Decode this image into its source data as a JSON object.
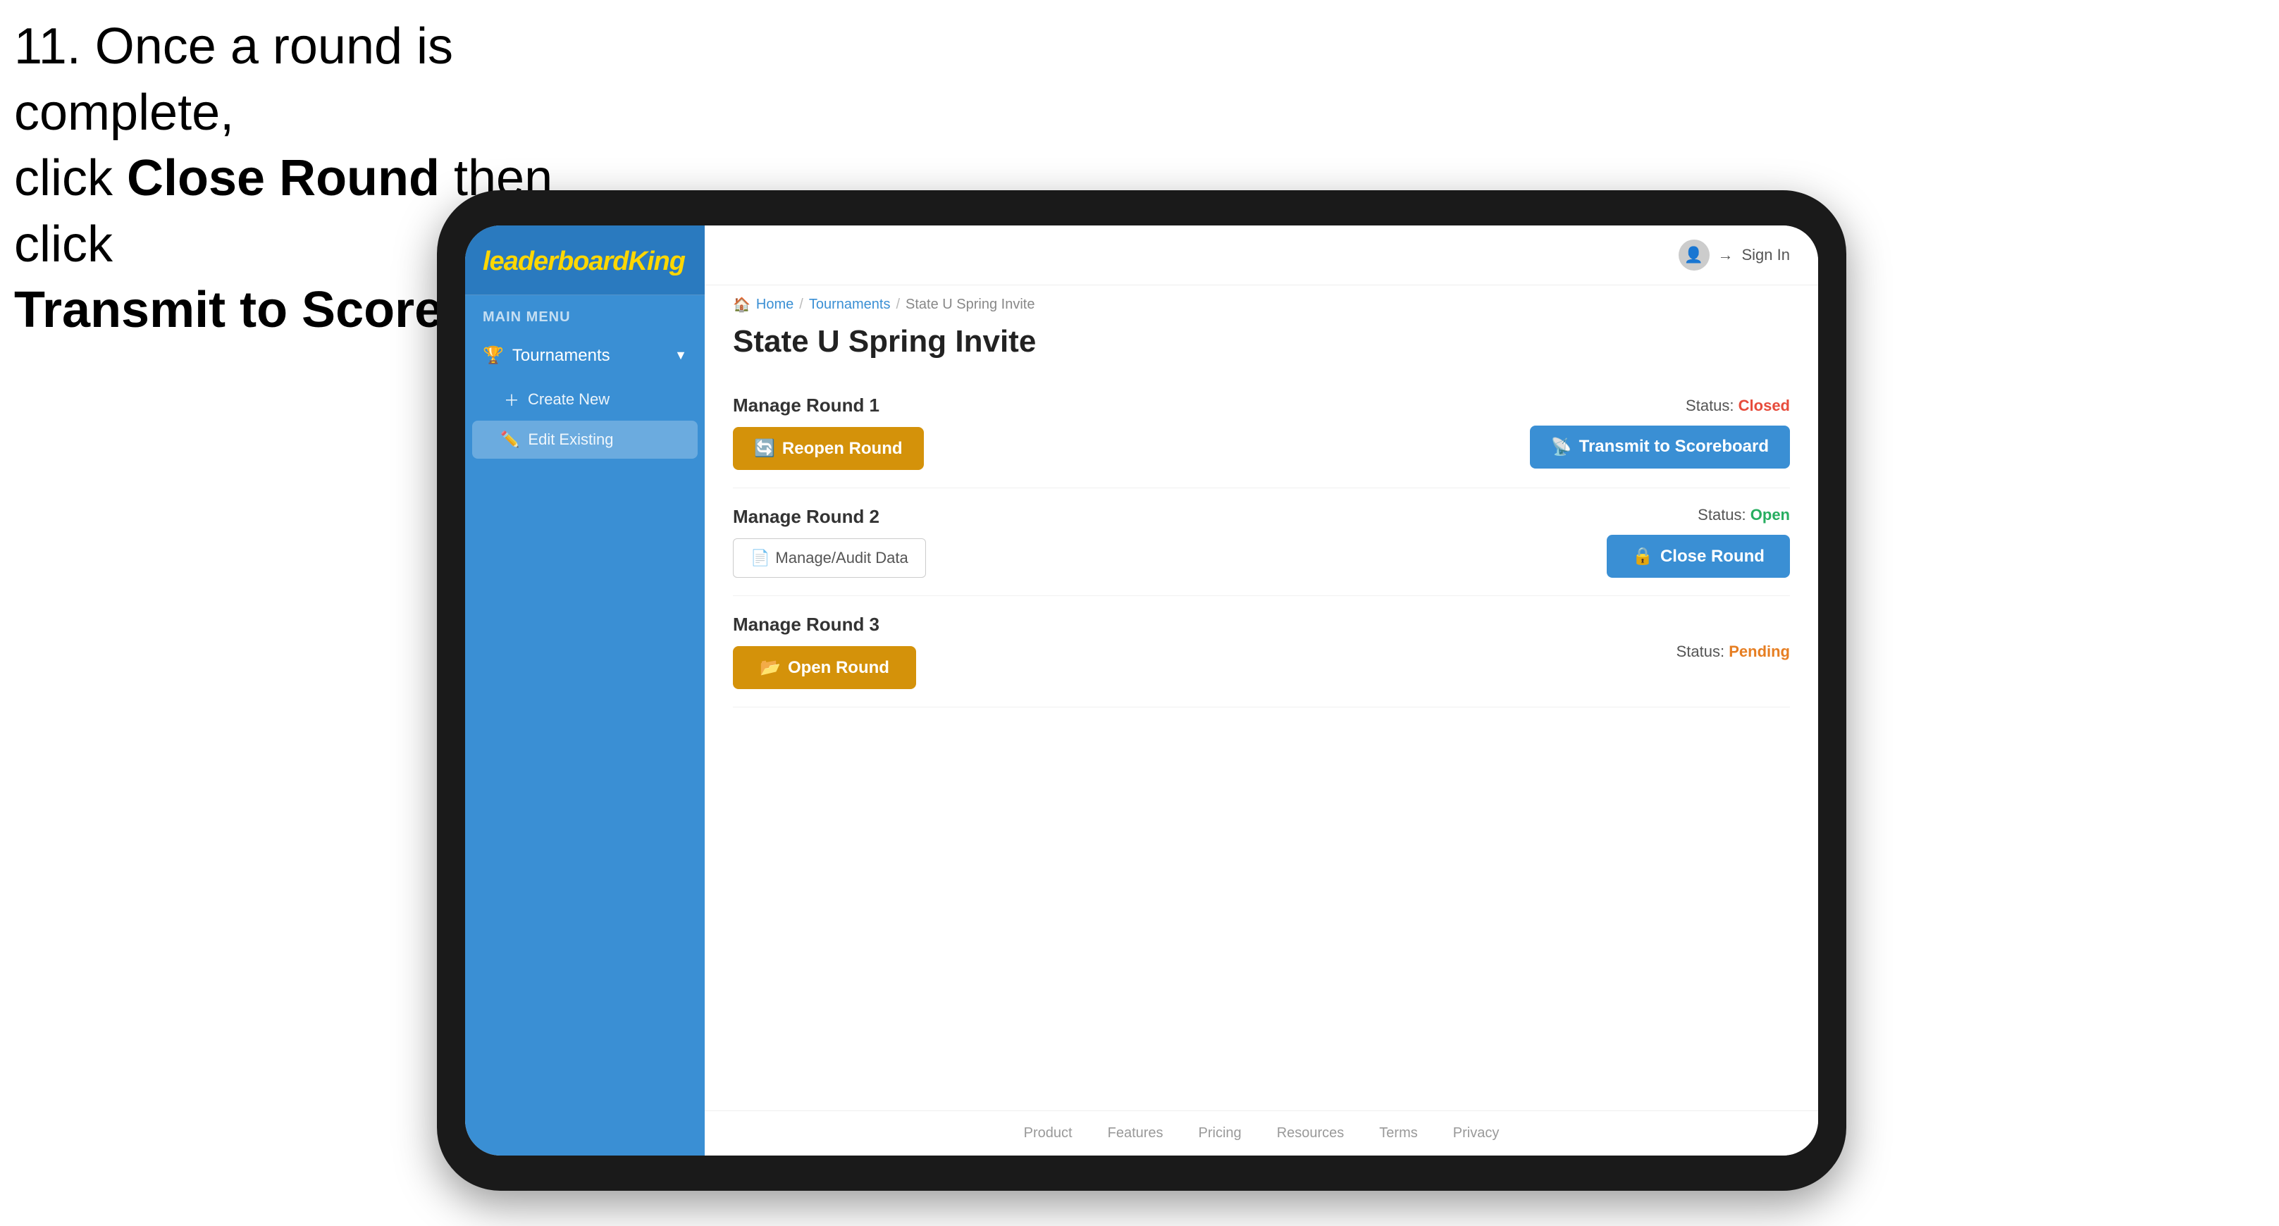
{
  "instruction": {
    "line1": "11. Once a round is complete,",
    "line2": "click ",
    "bold1": "Close Round",
    "line3": " then click",
    "bold2": "Transmit to Scoreboard."
  },
  "breadcrumb": {
    "home": "Home",
    "separator1": "/",
    "tournaments": "Tournaments",
    "separator2": "/",
    "current": "State U Spring Invite"
  },
  "header": {
    "sign_in": "Sign In"
  },
  "page": {
    "title": "State U Spring Invite"
  },
  "sidebar": {
    "logo": "leaderboard",
    "logo_brand": "King",
    "main_menu_label": "MAIN MENU",
    "tournaments_label": "Tournaments",
    "create_new_label": "Create New",
    "edit_existing_label": "Edit Existing"
  },
  "rounds": [
    {
      "manage_label": "Manage Round 1",
      "status_label": "Status:",
      "status_value": "Closed",
      "status_type": "closed",
      "primary_button": "Reopen Round",
      "primary_button_type": "gold",
      "secondary_button": "Transmit to Scoreboard",
      "secondary_button_type": "blue"
    },
    {
      "manage_label": "Manage Round 2",
      "status_label": "Status:",
      "status_value": "Open",
      "status_type": "open",
      "audit_button": "Manage/Audit Data",
      "secondary_button": "Close Round",
      "secondary_button_type": "blue"
    },
    {
      "manage_label": "Manage Round 3",
      "status_label": "Status:",
      "status_value": "Pending",
      "status_type": "pending",
      "primary_button": "Open Round",
      "primary_button_type": "gold"
    }
  ],
  "footer": {
    "links": [
      "Product",
      "Features",
      "Pricing",
      "Resources",
      "Terms",
      "Privacy"
    ]
  }
}
